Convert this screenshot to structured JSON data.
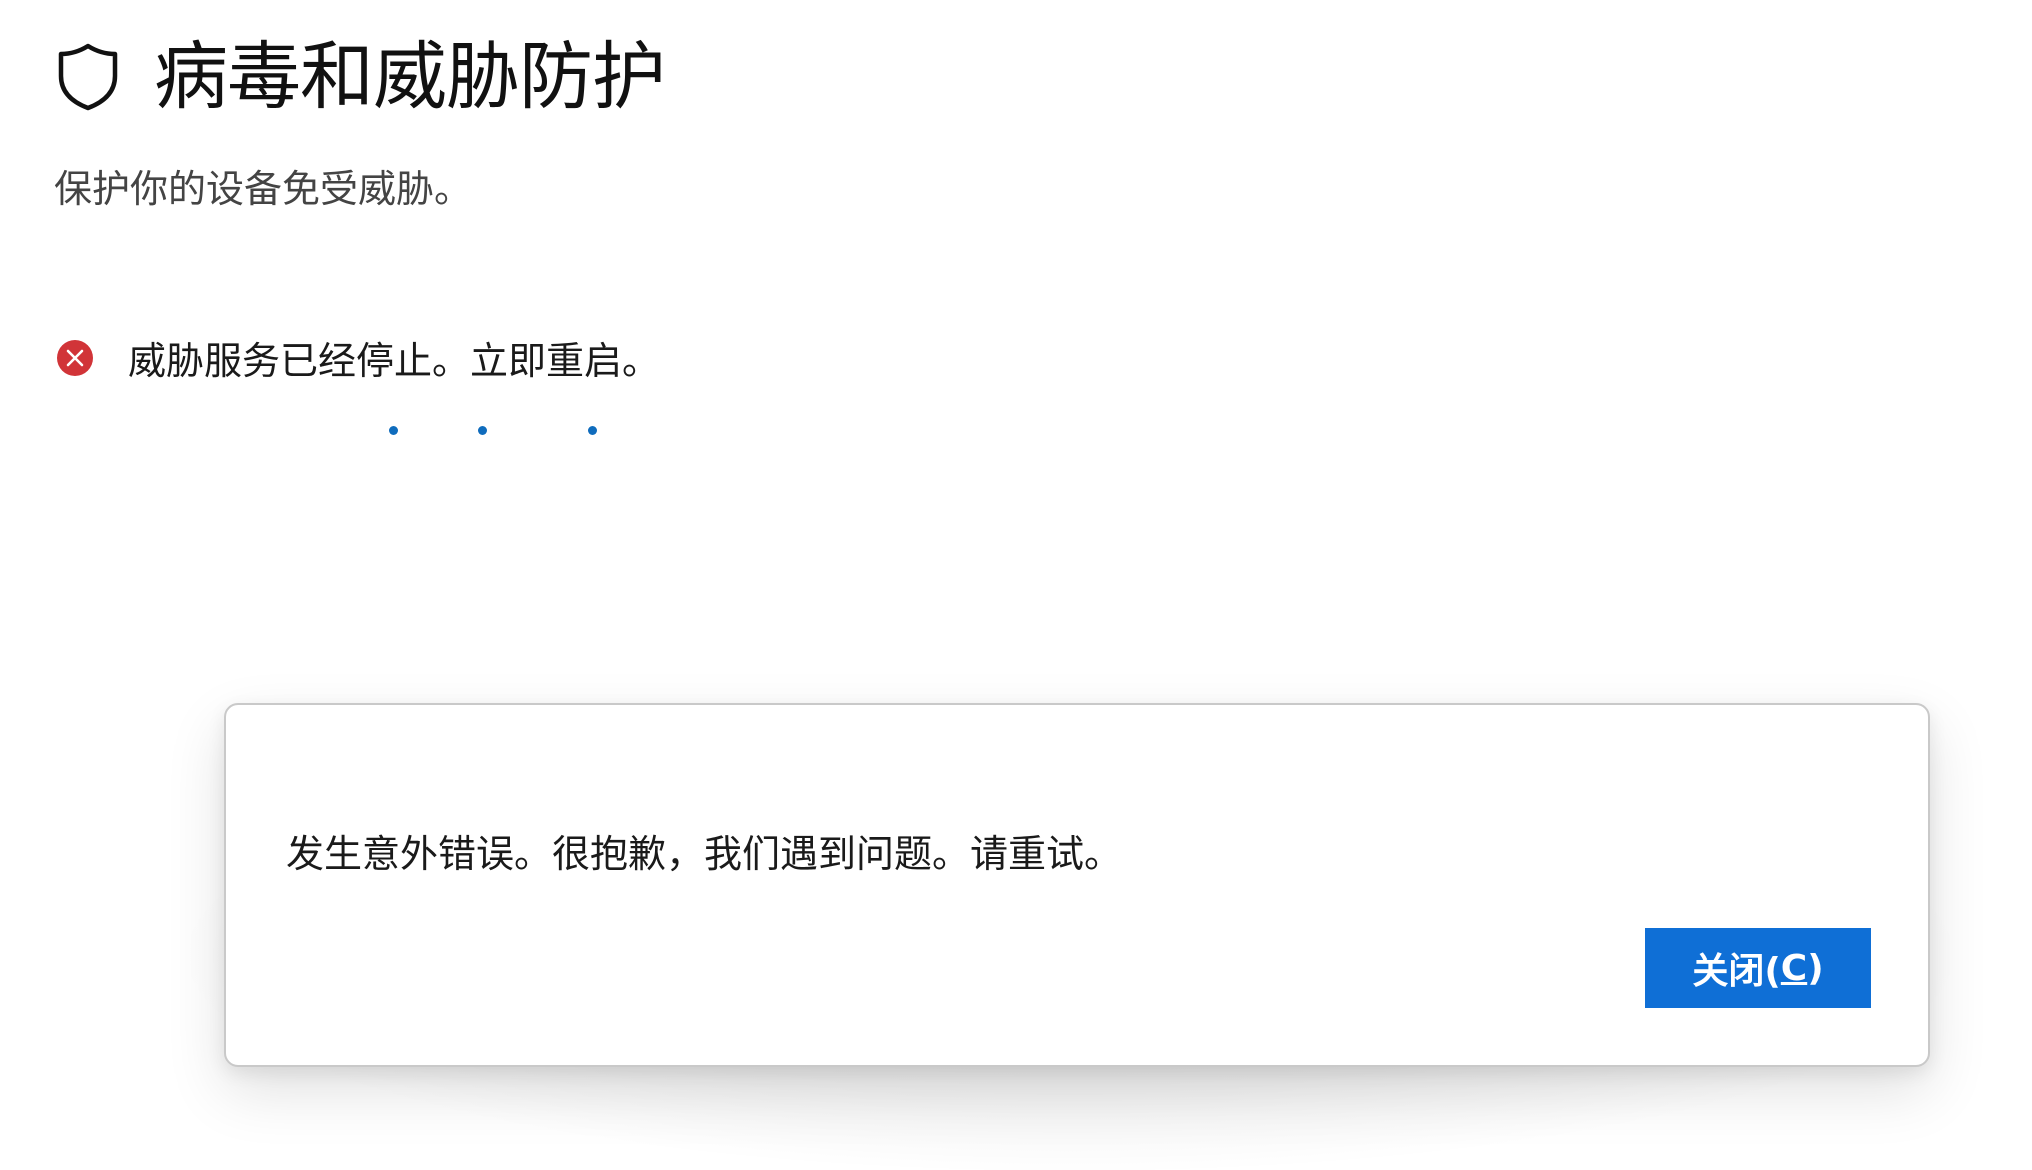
{
  "header": {
    "icon": "shield-icon",
    "title": "病毒和威胁防护",
    "subtitle": "保护你的设备免受威胁。"
  },
  "status": {
    "icon": "error-circle-icon",
    "icon_color": "#d13438",
    "text": "威胁服务已经停止。立即重启。"
  },
  "loading": {
    "indicator": "progress-dots",
    "color": "#0f6cbd"
  },
  "dialog": {
    "message": "发生意外错误。很抱歉，我们遇到问题。请重试。",
    "close_button": {
      "label_prefix": "关闭(",
      "accelerator": "C",
      "label_suffix": ")",
      "color": "#0f6fd6"
    }
  }
}
